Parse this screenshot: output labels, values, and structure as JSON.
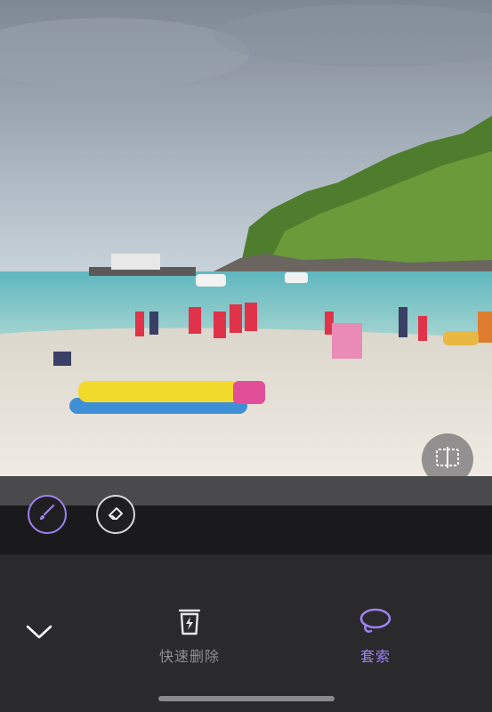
{
  "photo": {
    "description_icon": "beach-photo"
  },
  "compare": {
    "icon": "compare-split-icon"
  },
  "tools": {
    "brush": {
      "icon": "brush-icon",
      "active": true
    },
    "eraser": {
      "icon": "eraser-icon",
      "active": false
    }
  },
  "actions": {
    "collapse_icon": "chevron-down-icon",
    "quick_delete_label": "快速删除",
    "lasso_label": "套索"
  },
  "colors": {
    "accent": "#9b82f0",
    "panel": "#2a2a2d",
    "muted_text": "#8e8e93"
  }
}
